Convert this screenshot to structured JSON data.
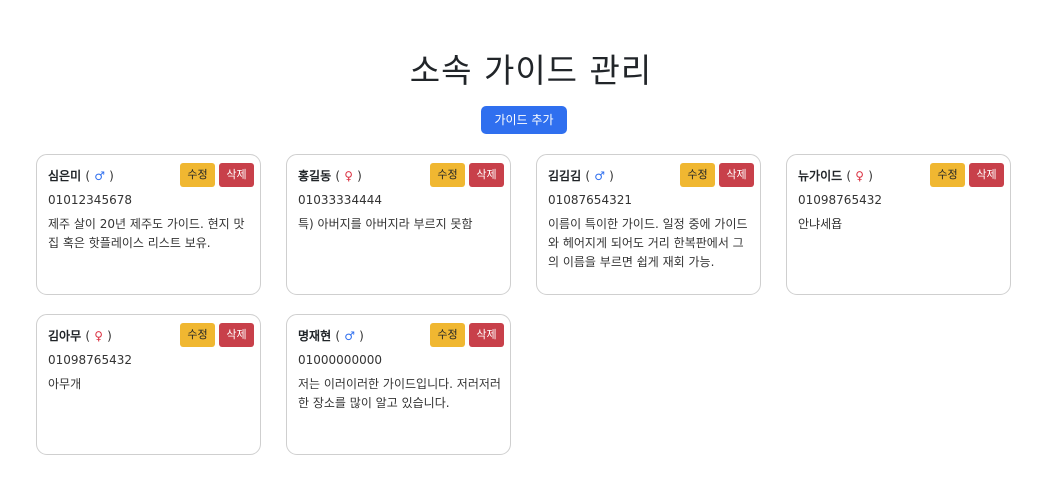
{
  "page": {
    "title": "소속 가이드 관리",
    "add_button_label": "가이드 추가"
  },
  "buttons": {
    "edit_label": "수정",
    "delete_label": "삭제"
  },
  "guides": [
    {
      "name": "심은미",
      "gender": "♂",
      "phone": "01012345678",
      "description": "제주 살이 20년 제주도 가이드. 현지 맛집 혹은 핫플레이스 리스트 보유."
    },
    {
      "name": "홍길동",
      "gender": "♀",
      "phone": "01033334444",
      "description": "특) 아버지를 아버지라 부르지 못함"
    },
    {
      "name": "김김김",
      "gender": "♂",
      "phone": "01087654321",
      "description": "이름이 특이한 가이드. 일정 중에 가이드와 헤어지게 되어도 거리 한복판에서 그의 이름을 부르면 쉽게 재회 가능."
    },
    {
      "name": "뉴가이드",
      "gender": "♀",
      "phone": "01098765432",
      "description": "안냐세욥"
    },
    {
      "name": "김아무",
      "gender": "♀",
      "phone": "01098765432",
      "description": "아무개"
    },
    {
      "name": "명재현",
      "gender": "♂",
      "phone": "01000000000",
      "description": "저는 이러이러한 가이드입니다. 저러저러한 장소를 많이 알고 있습니다."
    }
  ],
  "colors": {
    "primary": "#2f6fef",
    "warning": "#f0b731",
    "danger": "#c8404a",
    "male": "#2f6fef",
    "female": "#dc3545"
  }
}
